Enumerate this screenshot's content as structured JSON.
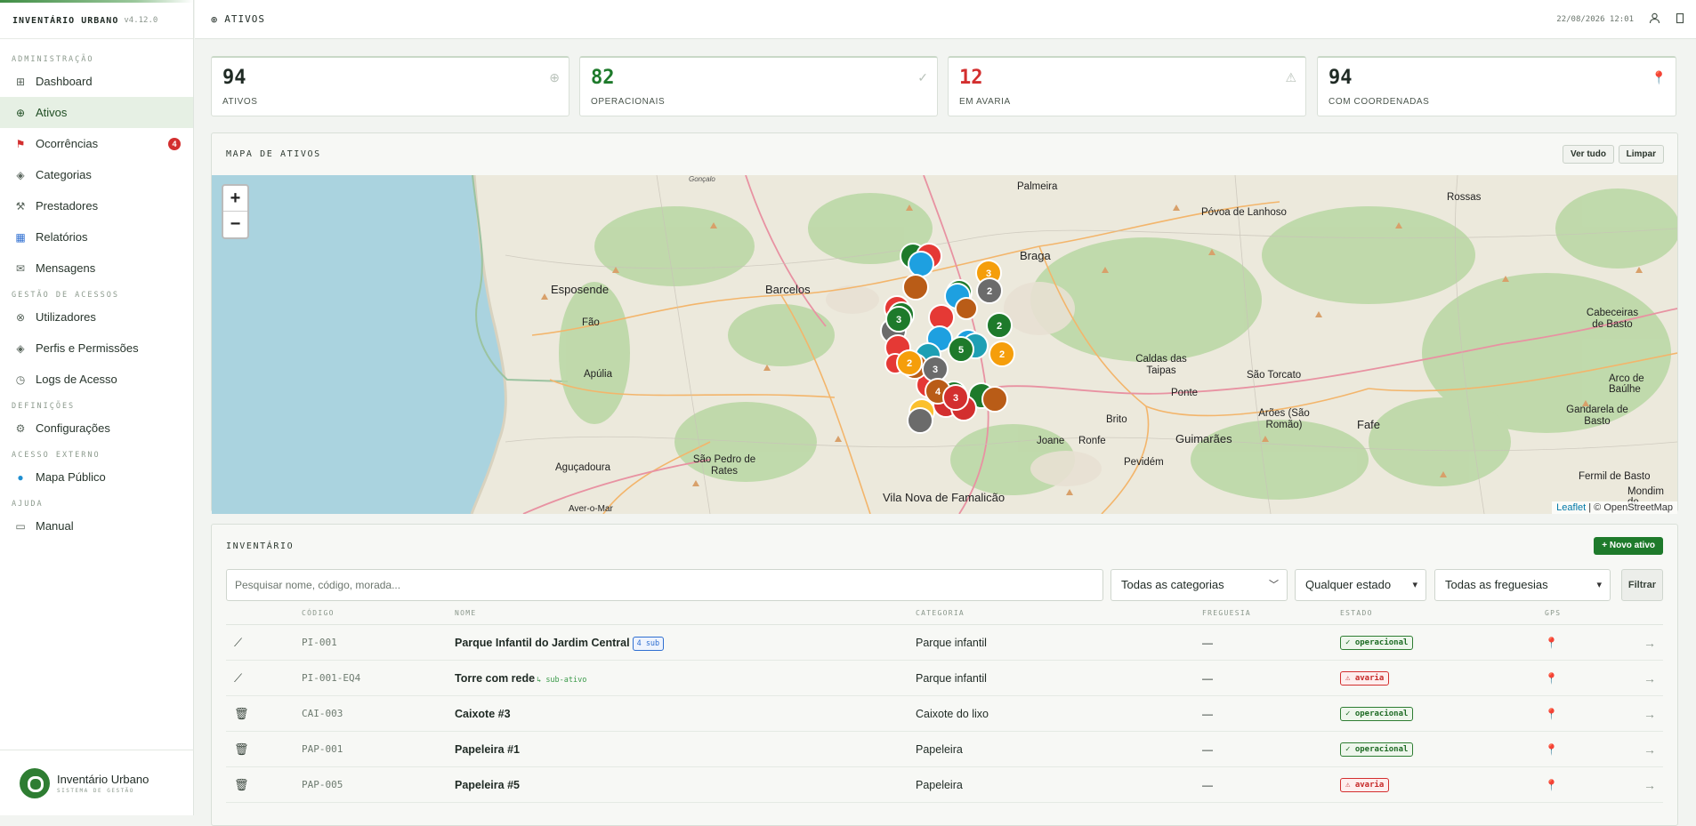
{
  "app": {
    "name": "INVENTÁRIO URBANO",
    "version": "v4.12.0"
  },
  "sidebar": {
    "sections": [
      {
        "label": "ADMINISTRAÇÃO",
        "items": [
          {
            "label": "Dashboard",
            "icon": "grid-icon"
          },
          {
            "label": "Ativos",
            "icon": "globe-icon",
            "active": true
          },
          {
            "label": "Ocorrências",
            "icon": "flag-icon",
            "badge": "4"
          },
          {
            "label": "Categorias",
            "icon": "diamond-icon"
          },
          {
            "label": "Prestadores",
            "icon": "tools-icon"
          },
          {
            "label": "Relatórios",
            "icon": "bar-chart-icon"
          },
          {
            "label": "Mensagens",
            "icon": "mail-icon"
          }
        ]
      },
      {
        "label": "GESTÃO DE ACESSOS",
        "items": [
          {
            "label": "Utilizadores",
            "icon": "users-icon"
          },
          {
            "label": "Perfis e Permissões",
            "icon": "diamond-icon"
          },
          {
            "label": "Logs de Acesso",
            "icon": "clock-icon"
          }
        ]
      },
      {
        "label": "DEFINIÇÕES",
        "items": [
          {
            "label": "Configurações",
            "icon": "gear-icon"
          }
        ]
      },
      {
        "label": "ACESSO EXTERNO",
        "items": [
          {
            "label": "Mapa Público",
            "icon": "earth-icon"
          }
        ]
      },
      {
        "label": "AJUDA",
        "items": [
          {
            "label": "Manual",
            "icon": "book-icon"
          }
        ]
      }
    ],
    "footer": {
      "title": "Inventário Urbano",
      "subtitle": "SISTEMA DE GESTÃO"
    }
  },
  "topbar": {
    "title": "ATIVOS",
    "datetime": "22/08/2026 12:01"
  },
  "stats": [
    {
      "value": "94",
      "label": "ATIVOS",
      "color": "#1f2a24",
      "icon": "⊕"
    },
    {
      "value": "82",
      "label": "OPERACIONAIS",
      "color": "#1e7a2b",
      "icon": "✓"
    },
    {
      "value": "12",
      "label": "EM AVARIA",
      "color": "#d32f2f",
      "icon": "⚠"
    },
    {
      "value": "94",
      "label": "COM COORDENADAS",
      "color": "#1f2a24",
      "icon": "📍"
    }
  ],
  "map": {
    "title": "MAPA DE ATIVOS",
    "btn_all": "Ver tudo",
    "btn_clear": "Limpar",
    "zoom_in": "+",
    "zoom_out": "−",
    "attribution_leaflet": "Leaflet",
    "attribution_rest": "| © OpenStreetMap",
    "places": [
      "Gonçalo",
      "Palmeira",
      "Póvoa de Lanhoso",
      "Rossas",
      "Braga",
      "Esposende",
      "Barcelos",
      "Fão",
      "Apúlia",
      "Caldas das Taipas",
      "São Torcato",
      "Cabeceiras de Basto",
      "Arco de Baúlhe",
      "Gandarela de Basto",
      "Ponte",
      "Brito",
      "Arões (São Romão)",
      "Fafe",
      "Guimarães",
      "Joane",
      "Ronfe",
      "Pevidém",
      "Aguçadoura",
      "São Pedro de Rates",
      "Vila Nova de Famalicão",
      "Fermil de Basto",
      "Mondim de",
      "Aver-o-Mar"
    ],
    "cluster_counts": [
      "3",
      "2",
      "2",
      "3",
      "5",
      "2",
      "3",
      "4",
      "3",
      "2"
    ]
  },
  "inventory": {
    "title": "INVENTÁRIO",
    "new_button": "+ Novo ativo",
    "search_placeholder": "Pesquisar nome, código, morada...",
    "filters": {
      "category": "Todas as categorias",
      "state": "Qualquer estado",
      "parish": "Todas as freguesias",
      "button": "Filtrar"
    },
    "columns": [
      "CÓDIGO",
      "NOME",
      "CATEGORIA",
      "FREGUESIA",
      "ESTADO",
      "GPS"
    ],
    "rows": [
      {
        "code": "PI-001",
        "name": "Parque Infantil do Jardim Central",
        "tag": "4 sub",
        "category": "Parque infantil",
        "parish": "—",
        "status": "✓ operacional",
        "status_type": "ok",
        "icon": "slide-icon"
      },
      {
        "code": "PI-001-EQ4",
        "name": "Torre com rede",
        "sub": "↳ sub-ativo",
        "category": "Parque infantil",
        "parish": "—",
        "status": "⚠ avaria",
        "status_type": "bad",
        "icon": "slide-icon"
      },
      {
        "code": "CAI-003",
        "name": "Caixote #3",
        "category": "Caixote do lixo",
        "parish": "—",
        "status": "✓ operacional",
        "status_type": "ok",
        "icon": "trash-icon"
      },
      {
        "code": "PAP-001",
        "name": "Papeleira #1",
        "category": "Papeleira",
        "parish": "—",
        "status": "✓ operacional",
        "status_type": "ok",
        "icon": "trash-icon"
      },
      {
        "code": "PAP-005",
        "name": "Papeleira #5",
        "category": "Papeleira",
        "parish": "—",
        "status": "⚠ avaria",
        "status_type": "bad",
        "icon": "trash-icon"
      }
    ]
  }
}
